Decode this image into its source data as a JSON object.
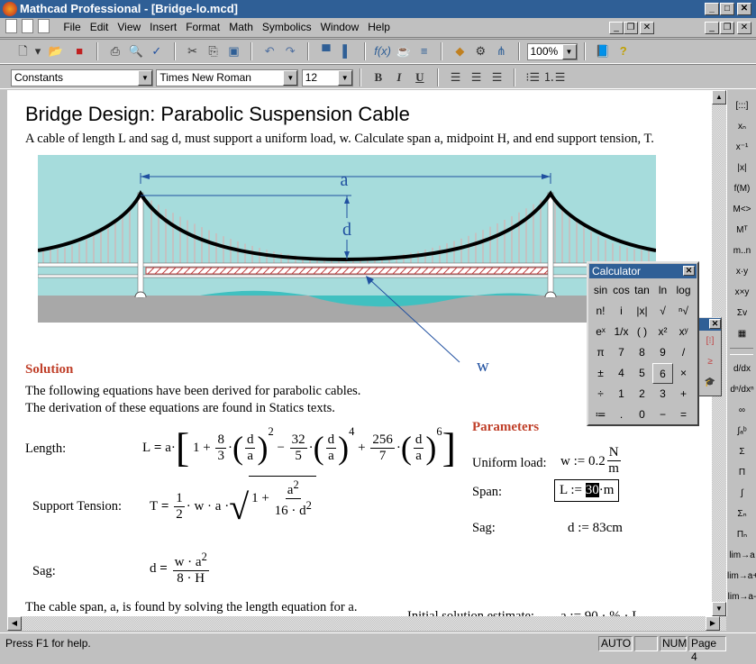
{
  "window": {
    "title": "Mathcad Professional - [Bridge-lo.mcd]"
  },
  "menu": [
    "File",
    "Edit",
    "View",
    "Insert",
    "Format",
    "Math",
    "Symbolics",
    "Window",
    "Help"
  ],
  "toolbar": {
    "zoom": "100%"
  },
  "format": {
    "style": "Constants",
    "font": "Times New Roman",
    "size": "12",
    "bold": "B",
    "italic": "I",
    "underline": "U"
  },
  "doc": {
    "title": "Bridge Design:  Parabolic Suspension Cable",
    "intro": "A cable of length L and sag d, must support a uniform load, w.  Calculate span a, midpoint H, and end support tension, T.",
    "figure": {
      "label_a": "a",
      "label_d": "d",
      "label_w": "w",
      "colors": {
        "sky": "#a6dcdc",
        "water": "#40c0c0",
        "ground": "#a8a8a8"
      }
    },
    "solution_heading": "Solution",
    "solution_text1": "The following equations have been derived for parabolic cables.",
    "solution_text2": "The derivation of these equations are found in Statics texts.",
    "length_label": "Length:",
    "tension_label": "Support Tension:",
    "sag_label": "Sag:",
    "span_text": "The cable span, a, is found by solving the length equation for a.",
    "estimate_label": "Initial solution estimate:",
    "estimate_expr": "a := 90 · % · L",
    "parameters_heading": "Parameters",
    "uniform_load_label": "Uniform load:",
    "uniform_load_expr": "w := 0.2",
    "uniform_load_unit_num": "N",
    "uniform_load_unit_den": "m",
    "span_label": "Span:",
    "span_prefix": "L := ",
    "span_value": "30",
    "span_unit": "·m",
    "sag_param_label": "Sag:",
    "sag_expr": "d := 83cm"
  },
  "calculator": {
    "title": "Calculator",
    "keys": [
      "sin",
      "cos",
      "tan",
      "ln",
      "log",
      "n!",
      "i",
      "|x|",
      "√",
      "ⁿ√",
      "eˣ",
      "1/x",
      "( )",
      "x²",
      "xʸ",
      "π",
      "7",
      "8",
      "9",
      "/",
      "±",
      "4",
      "5",
      "6",
      "×",
      "÷",
      "1",
      "2",
      "3",
      "+",
      "≔",
      ".",
      "0",
      "−",
      "="
    ],
    "selected": "6"
  },
  "palette": [
    "[:::]",
    "xₙ",
    "x⁻¹",
    "|x|",
    "f(M)",
    "M<>",
    "Mᵀ",
    "m..n",
    "x·y",
    "x×y",
    "Σv",
    "▦",
    "d/dx",
    "dⁿ/dxⁿ",
    "∞",
    "∫ₐᵇ",
    "Σ",
    "Π",
    "∫",
    "Σₙ",
    "Πₙ",
    "lim→a",
    "lim→a+",
    "lim→a-"
  ],
  "status": {
    "help": "Press F1 for help.",
    "mode": "AUTO",
    "num": "NUM",
    "page": "Page 4"
  }
}
